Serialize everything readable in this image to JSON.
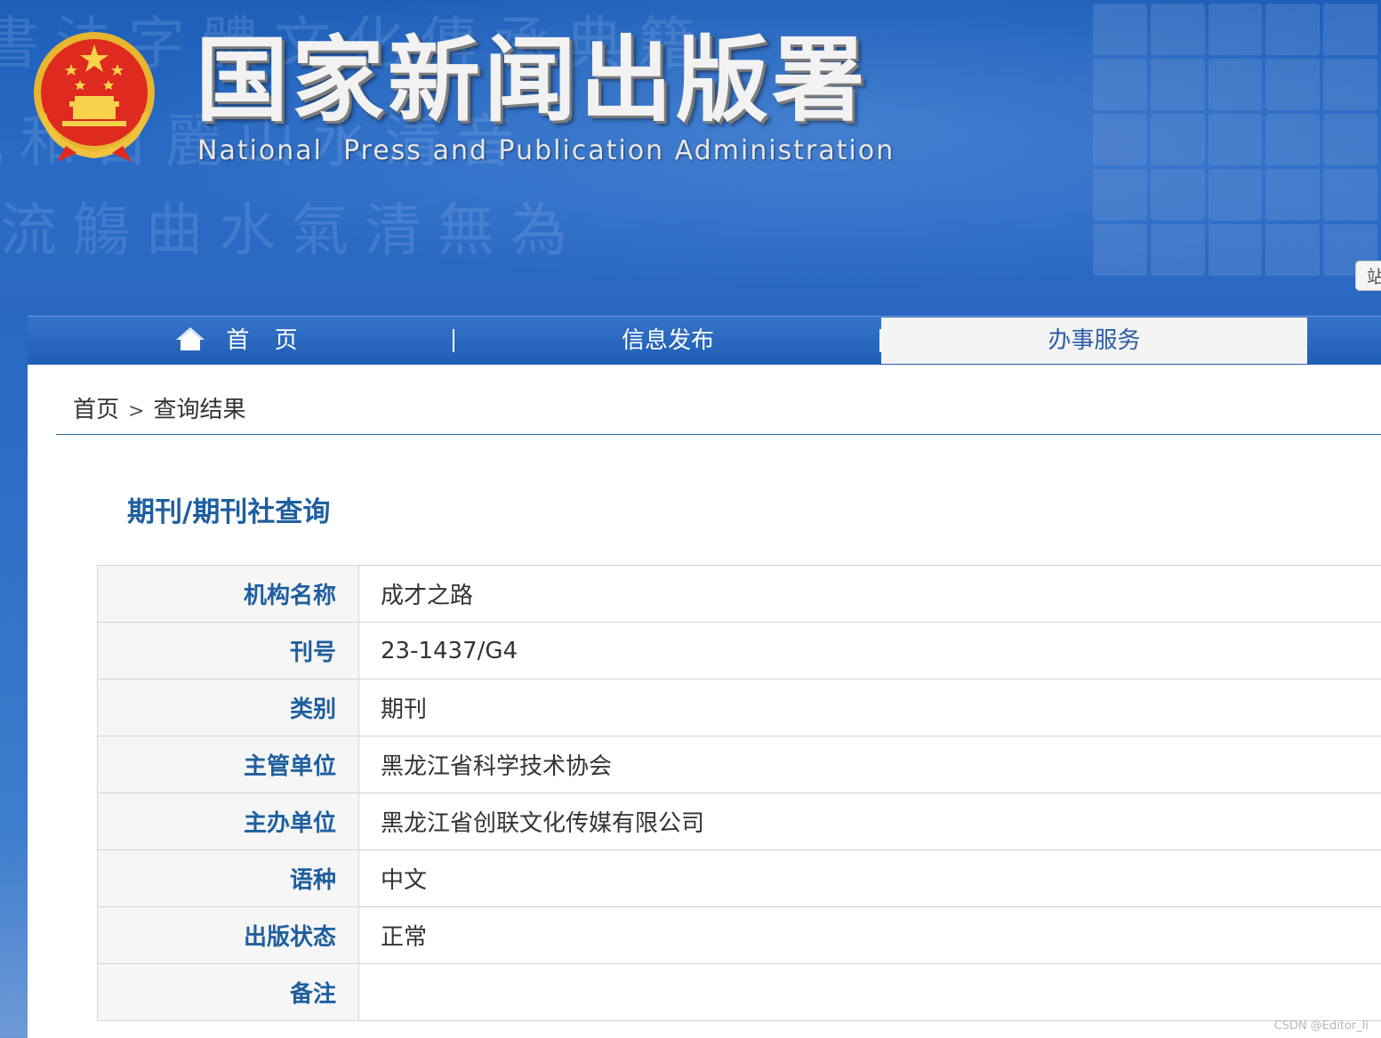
{
  "site": {
    "title": "国家新闻出版署",
    "subtitle": "National  Press and Publication Administration",
    "side_tab": "站"
  },
  "nav": {
    "items": [
      {
        "label": "首 页",
        "icon": "home-icon"
      },
      {
        "label": "信息发布"
      },
      {
        "label": "办事服务",
        "active": true
      }
    ]
  },
  "breadcrumb": {
    "home": "首页",
    "separator": ">",
    "current": "查询结果"
  },
  "page": {
    "heading": "期刊/期刊社查询"
  },
  "record": {
    "rows": [
      {
        "label": "机构名称",
        "value": "成才之路"
      },
      {
        "label": "刊号",
        "value": "23-1437/G4"
      },
      {
        "label": "类别",
        "value": "期刊"
      },
      {
        "label": "主管单位",
        "value": "黑龙江省科学技术协会"
      },
      {
        "label": "主办单位",
        "value": "黑龙江省创联文化传媒有限公司"
      },
      {
        "label": "语种",
        "value": "中文"
      },
      {
        "label": "出版状态",
        "value": "正常"
      },
      {
        "label": "备注",
        "value": ""
      }
    ]
  },
  "watermark": "CSDN @Editor_li",
  "colors": {
    "header_blue": "#1e5fb9",
    "accent_blue": "#1f5f9f",
    "active_tab_bg": "#f5f4f4"
  }
}
